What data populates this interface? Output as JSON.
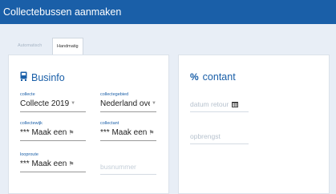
{
  "window": {
    "title": "Collectebussen aanmaken"
  },
  "tabs": [
    {
      "label": "Automatisch",
      "active": false
    },
    {
      "label": "Handmatig",
      "active": true
    }
  ],
  "businfo": {
    "heading": "Businfo",
    "fields": {
      "collecte": {
        "label": "collecte",
        "value": "Collecte 2019"
      },
      "collectegebied": {
        "label": "collectegebied",
        "value": "Nederland ove"
      },
      "collectewijk": {
        "label": "collectewijk",
        "value": "*** Maak een"
      },
      "collectant": {
        "label": "collectant",
        "value": "*** Maak een"
      },
      "looproute": {
        "label": "looproute",
        "value": "*** Maak een"
      }
    },
    "busnummer_placeholder": "busnummer"
  },
  "contant": {
    "heading": "contant",
    "heading_icon": "%",
    "datum_retour_placeholder": "datum retour",
    "opbrengst_placeholder": "opbrengst"
  },
  "colors": {
    "accent": "#1a5fa8",
    "background": "#e8eef6"
  }
}
